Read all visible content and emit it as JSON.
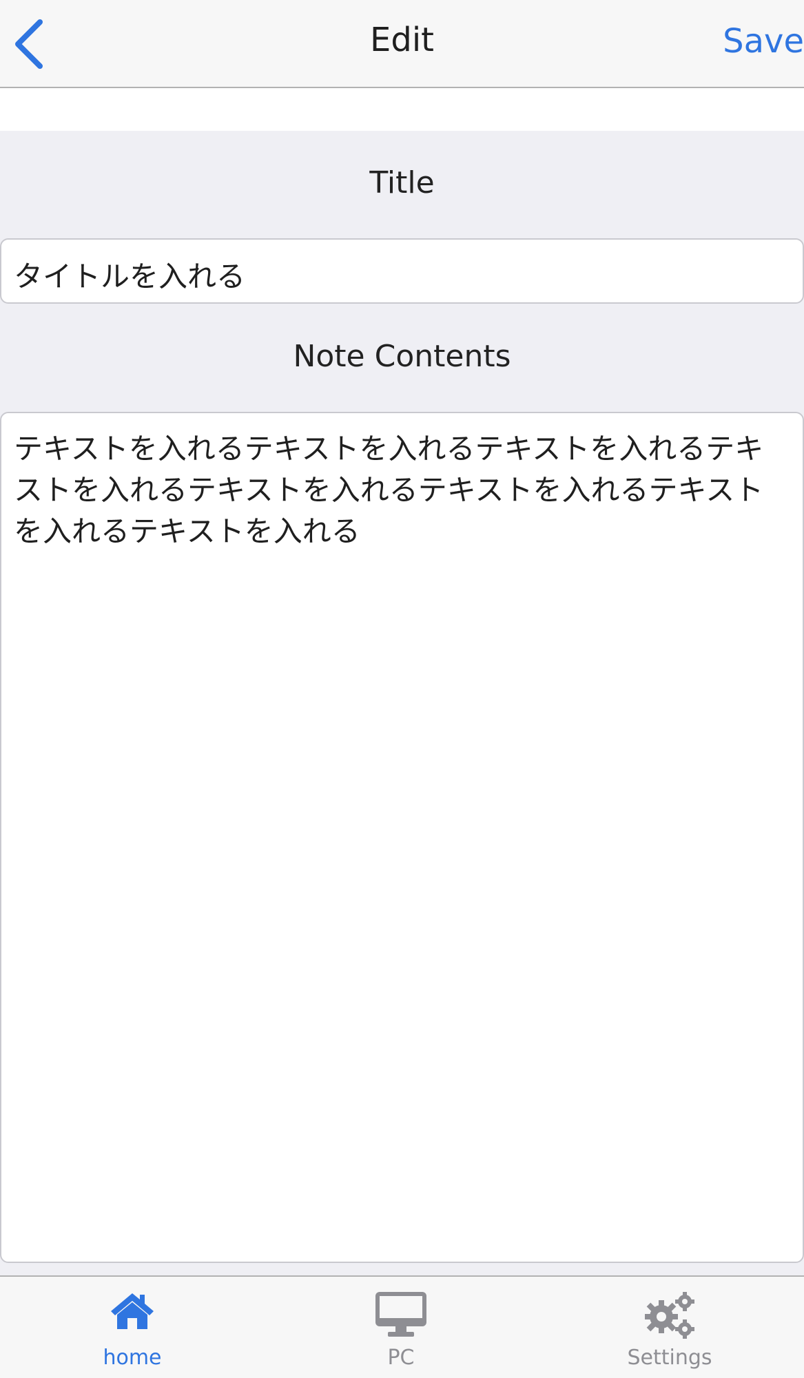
{
  "navbar": {
    "title": "Edit",
    "save_label": "Save",
    "back_icon": "chevron-left-icon"
  },
  "form": {
    "title_label": "Title",
    "title_value": "タイトルを入れる",
    "contents_label": "Note Contents",
    "contents_value": "テキストを入れるテキストを入れるテキストを入れるテキストを入れるテキストを入れるテキストを入れるテキストを入れるテキストを入れる"
  },
  "tabbar": {
    "items": [
      {
        "label": "home",
        "icon": "house-icon",
        "active": true
      },
      {
        "label": "PC",
        "icon": "desktop-icon",
        "active": false
      },
      {
        "label": "Settings",
        "icon": "gears-icon",
        "active": false
      }
    ]
  },
  "colors": {
    "accent": "#2f75e0",
    "inactive": "#8e8e93",
    "background": "#efeff4"
  }
}
